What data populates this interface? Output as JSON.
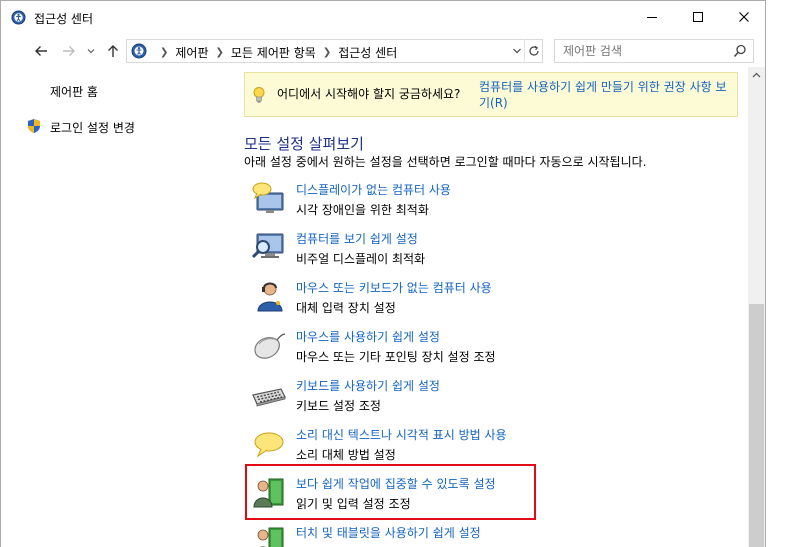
{
  "window": {
    "title": "접근성 센터",
    "minimize_icon": "minimize-icon",
    "maximize_icon": "maximize-icon",
    "close_icon": "close-icon"
  },
  "nav": {
    "back_icon": "back-arrow-icon",
    "forward_icon": "forward-arrow-icon",
    "recent_icon": "chevron-down-icon",
    "up_icon": "up-arrow-icon"
  },
  "address": {
    "crumbs": [
      "제어판",
      "모든 제어판 항목",
      "접근성 센터"
    ],
    "refresh_icon": "refresh-icon"
  },
  "search": {
    "placeholder": "제어판 검색"
  },
  "left": {
    "home": "제어판 홈",
    "login": "로그인 설정 변경"
  },
  "tip": {
    "text": "어디에서 시작해야 할지 궁금하세요?",
    "link": "컴퓨터를 사용하기 쉽게 만들기 위한 권장 사항 보기(R)"
  },
  "section": {
    "title": "모든 설정 살펴보기",
    "desc": "아래 설정 중에서 원하는 설정을 선택하면 로그인할 때마다 자동으로 시작됩니다."
  },
  "items": [
    {
      "title": "디스플레이가 없는 컴퓨터 사용",
      "desc": "시각 장애인을 위한 최적화",
      "icon": "monitor-speech-icon"
    },
    {
      "title": "컴퓨터를 보기 쉽게 설정",
      "desc": "비주얼 디스플레이 최적화",
      "icon": "monitor-magnifier-icon"
    },
    {
      "title": "마우스 또는 키보드가 없는 컴퓨터 사용",
      "desc": "대체 입력 장치 설정",
      "icon": "user-headset-icon"
    },
    {
      "title": "마우스를 사용하기 쉽게 설정",
      "desc": "마우스 또는 기타 포인팅 장치 설정 조정",
      "icon": "mouse-icon"
    },
    {
      "title": "키보드를 사용하기 쉽게 설정",
      "desc": "키보드 설정 조정",
      "icon": "keyboard-icon"
    },
    {
      "title": "소리 대신 텍스트나 시각적 표시 방법 사용",
      "desc": "소리 대체 방법 설정",
      "icon": "speech-bubble-icon"
    },
    {
      "title": "보다 쉽게 작업에 집중할 수 있도록 설정",
      "desc": "읽기 및 입력 설정 조정",
      "icon": "user-book-icon"
    },
    {
      "title": "터치 및 태블릿을 사용하기 쉽게 설정",
      "desc": "",
      "icon": "user-book-icon"
    }
  ],
  "colors": {
    "link": "#1464c0",
    "section_title": "#1e3287",
    "highlight": "#e00b14",
    "tip_background": "#fdfbd6"
  }
}
